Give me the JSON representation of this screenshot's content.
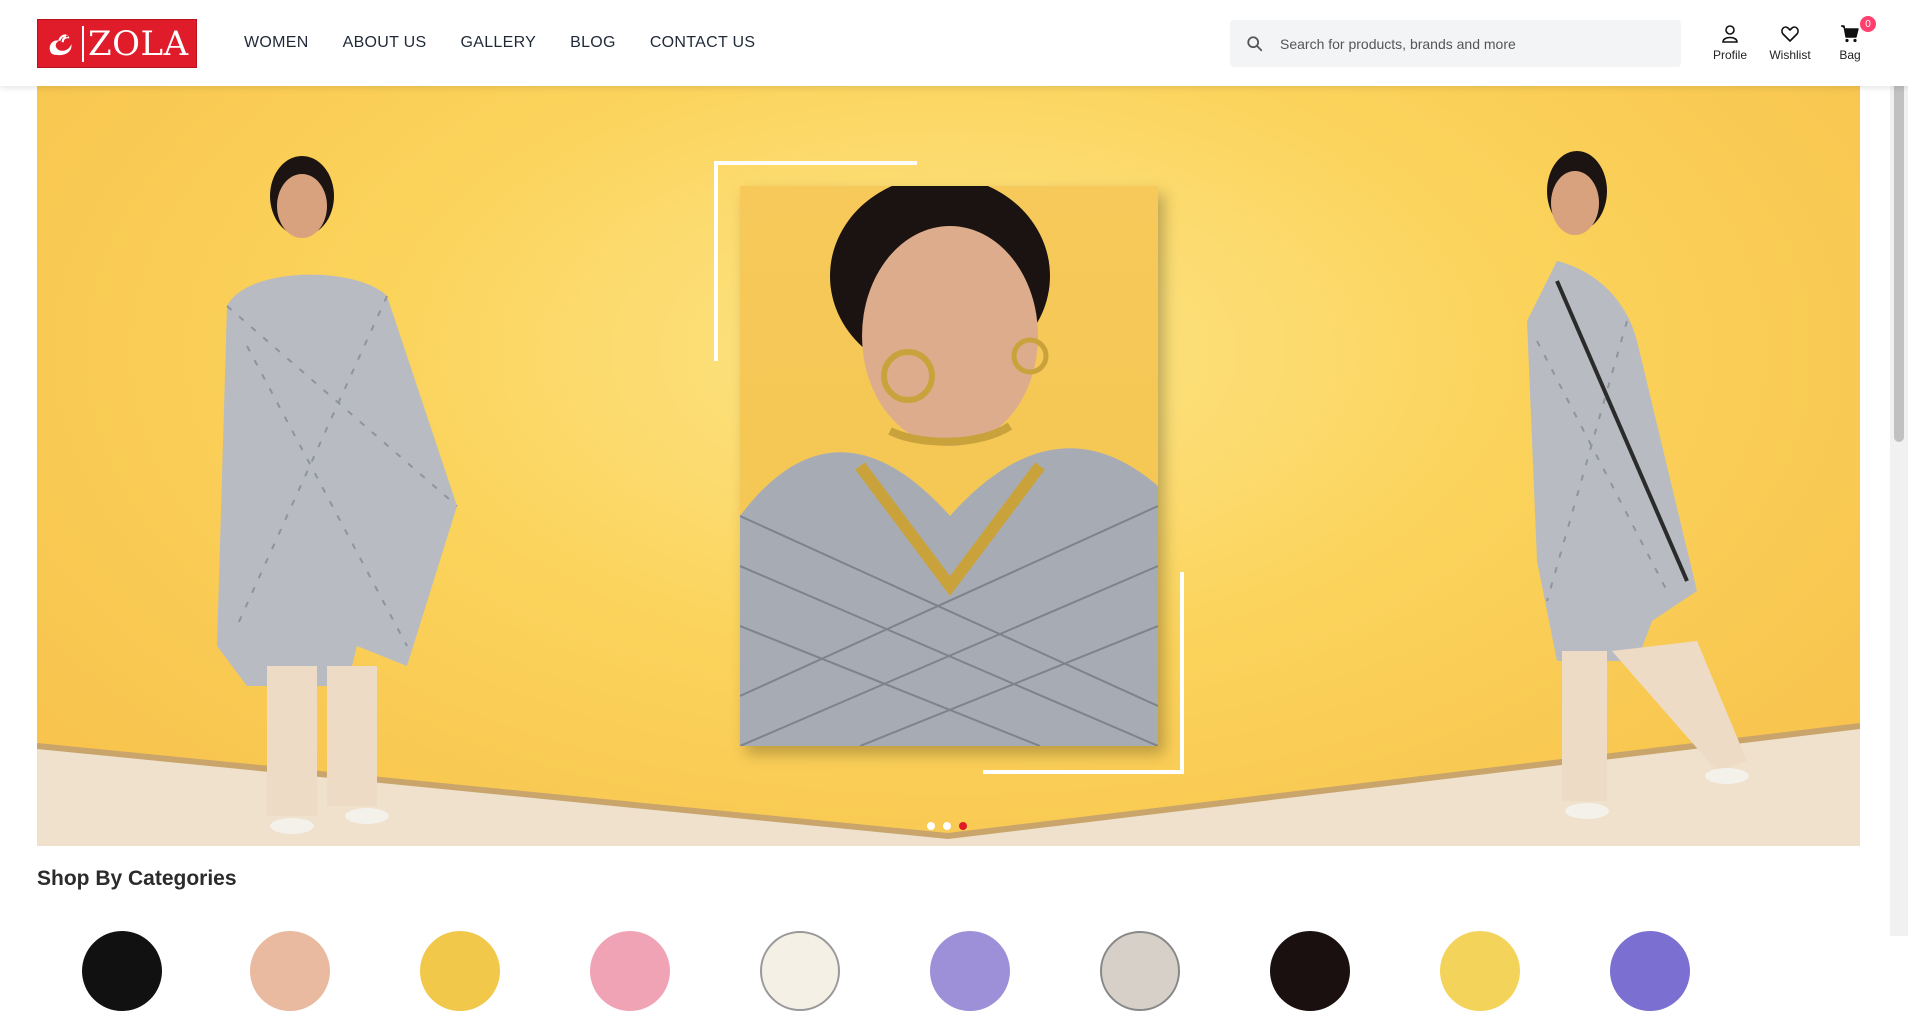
{
  "brand": {
    "logo_text": "ZOLA",
    "accent_color": "#e01b2a"
  },
  "nav": {
    "items": [
      {
        "label": "WOMEN"
      },
      {
        "label": "ABOUT US"
      },
      {
        "label": "GALLERY"
      },
      {
        "label": "BLOG"
      },
      {
        "label": "CONTACT US"
      }
    ]
  },
  "search": {
    "placeholder": "Search for products, brands and more",
    "icon": "search-icon"
  },
  "actions": {
    "profile_label": "Profile",
    "wishlist_label": "Wishlist",
    "bag_label": "Bag",
    "bag_count": "0"
  },
  "hero": {
    "slide_count": 3,
    "active_slide": 3,
    "background_color": "#fbd35b"
  },
  "categories": {
    "title": "Shop By Categories"
  }
}
